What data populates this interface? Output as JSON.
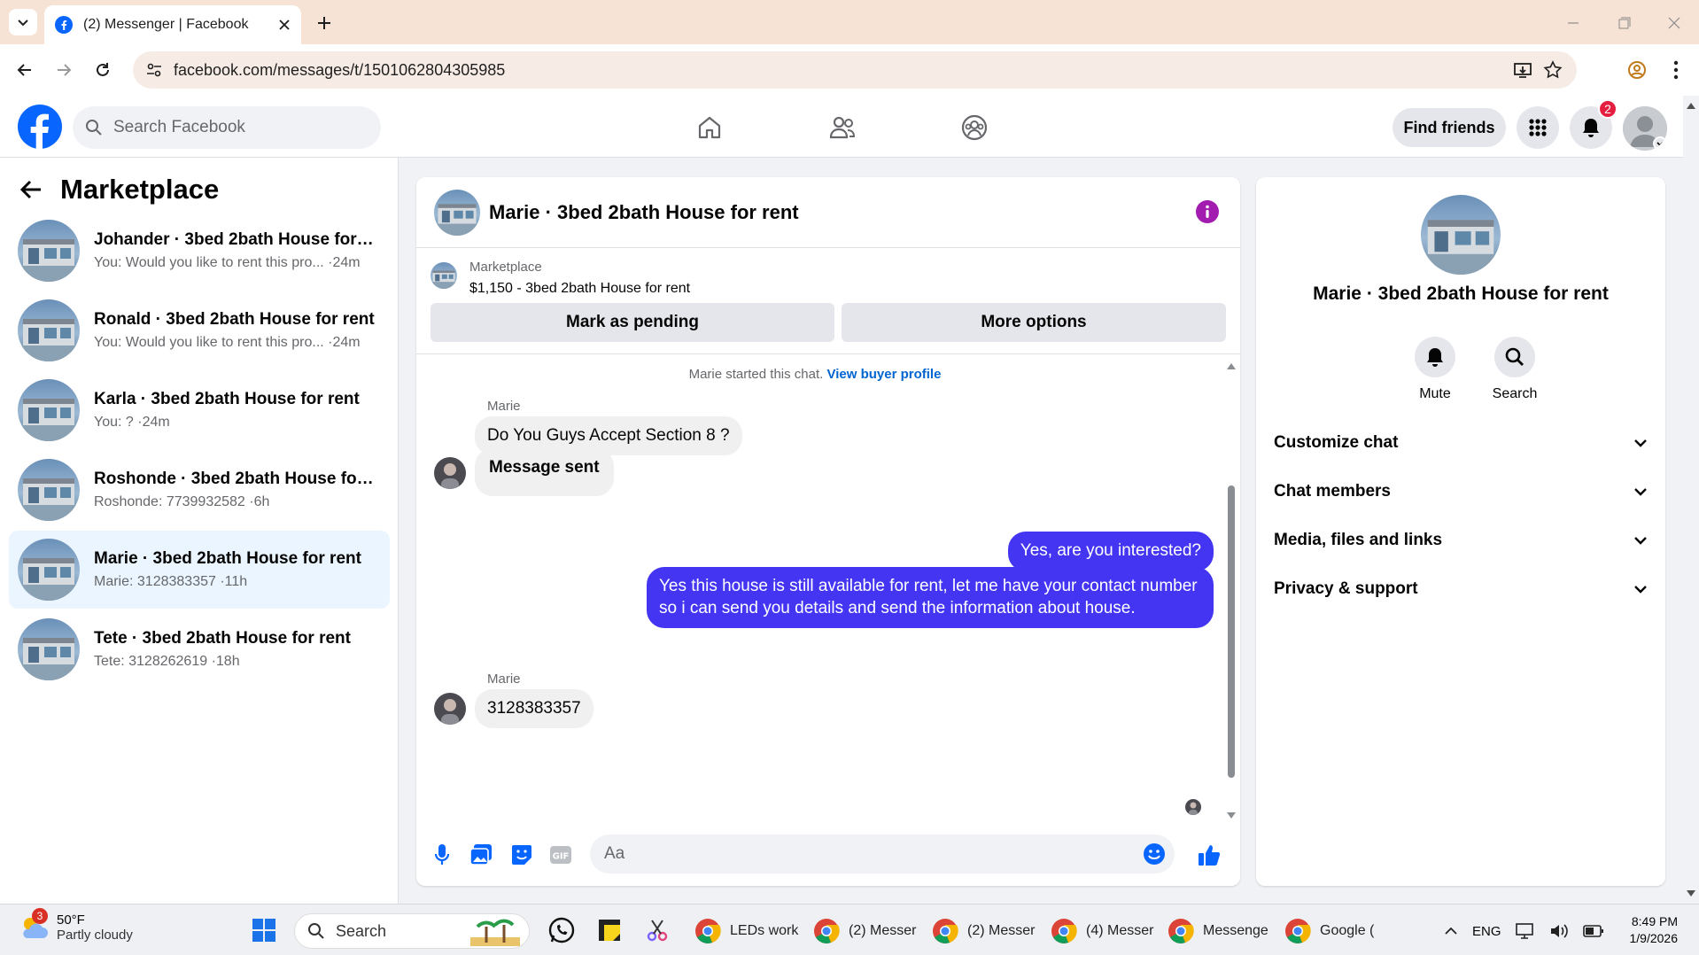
{
  "browser": {
    "tab_title": "(2) Messenger | Facebook",
    "url": "facebook.com/messages/t/1501062804305985"
  },
  "fb_header": {
    "search_placeholder": "Search Facebook",
    "find_friends": "Find friends",
    "notification_count": "2"
  },
  "sidebar": {
    "title": "Marketplace",
    "conversations": [
      {
        "name": "Johander · 3bed 2bath House for rent",
        "preview": "You: Would you like to rent this pro... ·24m"
      },
      {
        "name": "Ronald · 3bed 2bath House for rent",
        "preview": "You: Would you like to rent this pro... ·24m"
      },
      {
        "name": "Karla · 3bed 2bath House for rent",
        "preview": "You: ? ·24m"
      },
      {
        "name": "Roshonde · 3bed 2bath House for rent",
        "preview": "Roshonde: 7739932582 ·6h"
      },
      {
        "name": "Marie · 3bed 2bath House for rent",
        "preview": "Marie: 3128383357 ·11h"
      },
      {
        "name": "Tete · 3bed 2bath House for rent",
        "preview": "Tete: 3128262619 ·18h"
      }
    ]
  },
  "chat": {
    "title": "Marie · 3bed 2bath House for rent",
    "marketplace_label": "Marketplace",
    "listing": "$1,150 - 3bed 2bath House for rent",
    "mark_pending": "Mark as pending",
    "more_options": "More options",
    "started_text": "Marie started this chat.",
    "view_buyer": "View buyer profile",
    "sender_name": "Marie",
    "msg1": "Do You Guys Accept Section 8 ?",
    "msg2": "Message sent",
    "out1": "Yes, are you interested?",
    "out2": "Yes this house is still available for rent, let me have your contact number so i can send you details and send the information about house.",
    "msg3": "3128383357",
    "composer_placeholder": "Aa"
  },
  "right_panel": {
    "title": "Marie · 3bed 2bath House for rent",
    "mute": "Mute",
    "search": "Search",
    "sections": [
      "Customize chat",
      "Chat members",
      "Media, files and links",
      "Privacy & support"
    ]
  },
  "taskbar": {
    "weather_badge": "3",
    "temp": "50°F",
    "condition": "Partly cloudy",
    "search": "Search",
    "apps": [
      "LEDs work",
      "(2) Messer",
      "(2) Messer",
      "(4) Messer",
      "Messenge",
      "Google ("
    ],
    "lang": "ENG",
    "time": "8:49 PM",
    "date": "1/9/2026"
  },
  "colors": {
    "fb_blue": "#0866ff",
    "outgoing_bubble": "#4335f2",
    "active_conv": "#ebf5ff",
    "badge_red": "#e41e3f",
    "info_purple": "#a21caf"
  }
}
